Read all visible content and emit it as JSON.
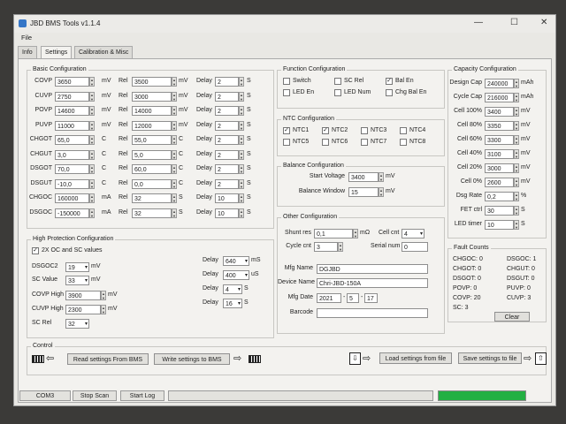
{
  "window": {
    "title": "JBD BMS Tools v1.1.4",
    "menu_file": "File"
  },
  "tabs": [
    "Info",
    "Settings",
    "Calibration & Misc"
  ],
  "basic": {
    "title": "Basic Configuration",
    "rows": [
      {
        "name": "COVP",
        "val": "3650",
        "unit": "mV",
        "rel": "3500",
        "rel_unit": "mV",
        "delay": "2",
        "delay_unit": "S"
      },
      {
        "name": "CUVP",
        "val": "2750",
        "unit": "mV",
        "rel": "3000",
        "rel_unit": "mV",
        "delay": "2",
        "delay_unit": "S"
      },
      {
        "name": "POVP",
        "val": "14600",
        "unit": "mV",
        "rel": "14000",
        "rel_unit": "mV",
        "delay": "2",
        "delay_unit": "S"
      },
      {
        "name": "PUVP",
        "val": "11000",
        "unit": "mV",
        "rel": "12000",
        "rel_unit": "mV",
        "delay": "2",
        "delay_unit": "S"
      },
      {
        "name": "CHGOT",
        "val": "65,0",
        "unit": "C",
        "rel": "55,0",
        "rel_unit": "C",
        "delay": "2",
        "delay_unit": "S"
      },
      {
        "name": "CHGUT",
        "val": "3,0",
        "unit": "C",
        "rel": "5,0",
        "rel_unit": "C",
        "delay": "2",
        "delay_unit": "S"
      },
      {
        "name": "DSGOT",
        "val": "70,0",
        "unit": "C",
        "rel": "60,0",
        "rel_unit": "C",
        "delay": "2",
        "delay_unit": "S"
      },
      {
        "name": "DSGUT",
        "val": "-10,0",
        "unit": "C",
        "rel": "0,0",
        "rel_unit": "C",
        "delay": "2",
        "delay_unit": "S"
      },
      {
        "name": "CHGOC",
        "val": "160000",
        "unit": "mA",
        "rel": "32",
        "rel_unit": "S",
        "delay": "10",
        "delay_unit": "S"
      },
      {
        "name": "DSGOC",
        "val": "-150000",
        "unit": "mA",
        "rel": "32",
        "rel_unit": "S",
        "delay": "10",
        "delay_unit": "S"
      }
    ],
    "rel_label": "Rel",
    "delay_label": "Delay"
  },
  "high": {
    "title": "High Protection Configuration",
    "check_label": "2X OC and SC values",
    "rows": [
      {
        "label": "DSGOC2",
        "value": "19",
        "unit": "mV"
      },
      {
        "label": "SC Value",
        "value": "33",
        "unit": "mV"
      },
      {
        "label": "COVP High",
        "value": "3900",
        "unit": "mV"
      },
      {
        "label": "CUVP High",
        "value": "2300",
        "unit": "mV"
      },
      {
        "label": "SC Rel",
        "value": "32",
        "unit": "S"
      }
    ],
    "delays": [
      {
        "label": "Delay",
        "value": "640",
        "unit": "mS"
      },
      {
        "label": "Delay",
        "value": "400",
        "unit": "uS"
      },
      {
        "label": "Delay",
        "value": "4",
        "unit": "S"
      },
      {
        "label": "Delay",
        "value": "16",
        "unit": "S"
      }
    ]
  },
  "function": {
    "title": "Function Configuration",
    "items": [
      {
        "label": "Switch",
        "checked": false
      },
      {
        "label": "SC Rel",
        "checked": false
      },
      {
        "label": "Bal En",
        "checked": true
      },
      {
        "label": "LED En",
        "checked": false
      },
      {
        "label": "LED Num",
        "checked": false
      },
      {
        "label": "Chg Bal En",
        "checked": false
      }
    ]
  },
  "ntc": {
    "title": "NTC Configuration",
    "items": [
      {
        "label": "NTC1",
        "checked": true
      },
      {
        "label": "NTC2",
        "checked": true
      },
      {
        "label": "NTC3",
        "checked": false
      },
      {
        "label": "NTC4",
        "checked": false
      },
      {
        "label": "NTC5",
        "checked": false
      },
      {
        "label": "NTC6",
        "checked": false
      },
      {
        "label": "NTC7",
        "checked": false
      },
      {
        "label": "NTC8",
        "checked": false
      }
    ]
  },
  "balance": {
    "title": "Balance Configuration",
    "start_label": "Start Voltage",
    "start_value": "3400",
    "start_unit": "mV",
    "window_label": "Balance Window",
    "window_value": "15",
    "window_unit": "mV"
  },
  "other": {
    "title": "Other Configuration",
    "shunt_label": "Shunt res",
    "shunt_value": "0,1",
    "shunt_unit": "mΩ",
    "cellcnt_label": "Cell cnt",
    "cellcnt_value": "4",
    "cycle_label": "Cycle cnt",
    "cycle_value": "3",
    "serial_label": "Serial num",
    "serial_value": "0",
    "mfg_label": "Mfg Name",
    "mfg_value": "DGJBD",
    "device_label": "Device Name",
    "device_value": "Chri-JBD-150A",
    "date_label": "Mfg Date",
    "date_y": "2021",
    "date_m": "5",
    "date_d": "17",
    "barcode_label": "Barcode",
    "barcode_value": ""
  },
  "capacity": {
    "title": "Capacity Configuration",
    "rows": [
      {
        "label": "Design Cap",
        "value": "240000",
        "unit": "mAh"
      },
      {
        "label": "Cycle Cap",
        "value": "216000",
        "unit": "mAh"
      },
      {
        "label": "Cell 100%",
        "value": "3400",
        "unit": "mV"
      },
      {
        "label": "Cell 80%",
        "value": "3350",
        "unit": "mV"
      },
      {
        "label": "Cell 60%",
        "value": "3300",
        "unit": "mV"
      },
      {
        "label": "Cell 40%",
        "value": "3100",
        "unit": "mV"
      },
      {
        "label": "Cell 20%",
        "value": "3000",
        "unit": "mV"
      },
      {
        "label": "Cell 0%",
        "value": "2600",
        "unit": "mV"
      },
      {
        "label": "Dsg Rate",
        "value": "0,2",
        "unit": "%"
      },
      {
        "label": "FET ctrl",
        "value": "30",
        "unit": "S"
      },
      {
        "label": "LED timer",
        "value": "10",
        "unit": "S"
      }
    ]
  },
  "fault": {
    "title": "Fault Counts",
    "left": [
      "CHGOC: 0",
      "CHGOT: 0",
      "DSGOT: 0",
      "POVP: 0",
      "COVP: 20",
      "SC: 3"
    ],
    "right": [
      "DSGOC: 1",
      "CHGUT: 0",
      "DSGUT: 0",
      "PUVP: 0",
      "CUVP: 3"
    ],
    "clear_label": "Clear"
  },
  "control": {
    "title": "Control",
    "read_label": "Read settings From BMS",
    "write_label": "Write settings to BMS",
    "load_label": "Load settings from file",
    "save_label": "Save settings to file"
  },
  "statusbar": {
    "port": "COM3",
    "stop_scan": "Stop Scan",
    "start_log": "Start Log",
    "progress": 1.0
  }
}
